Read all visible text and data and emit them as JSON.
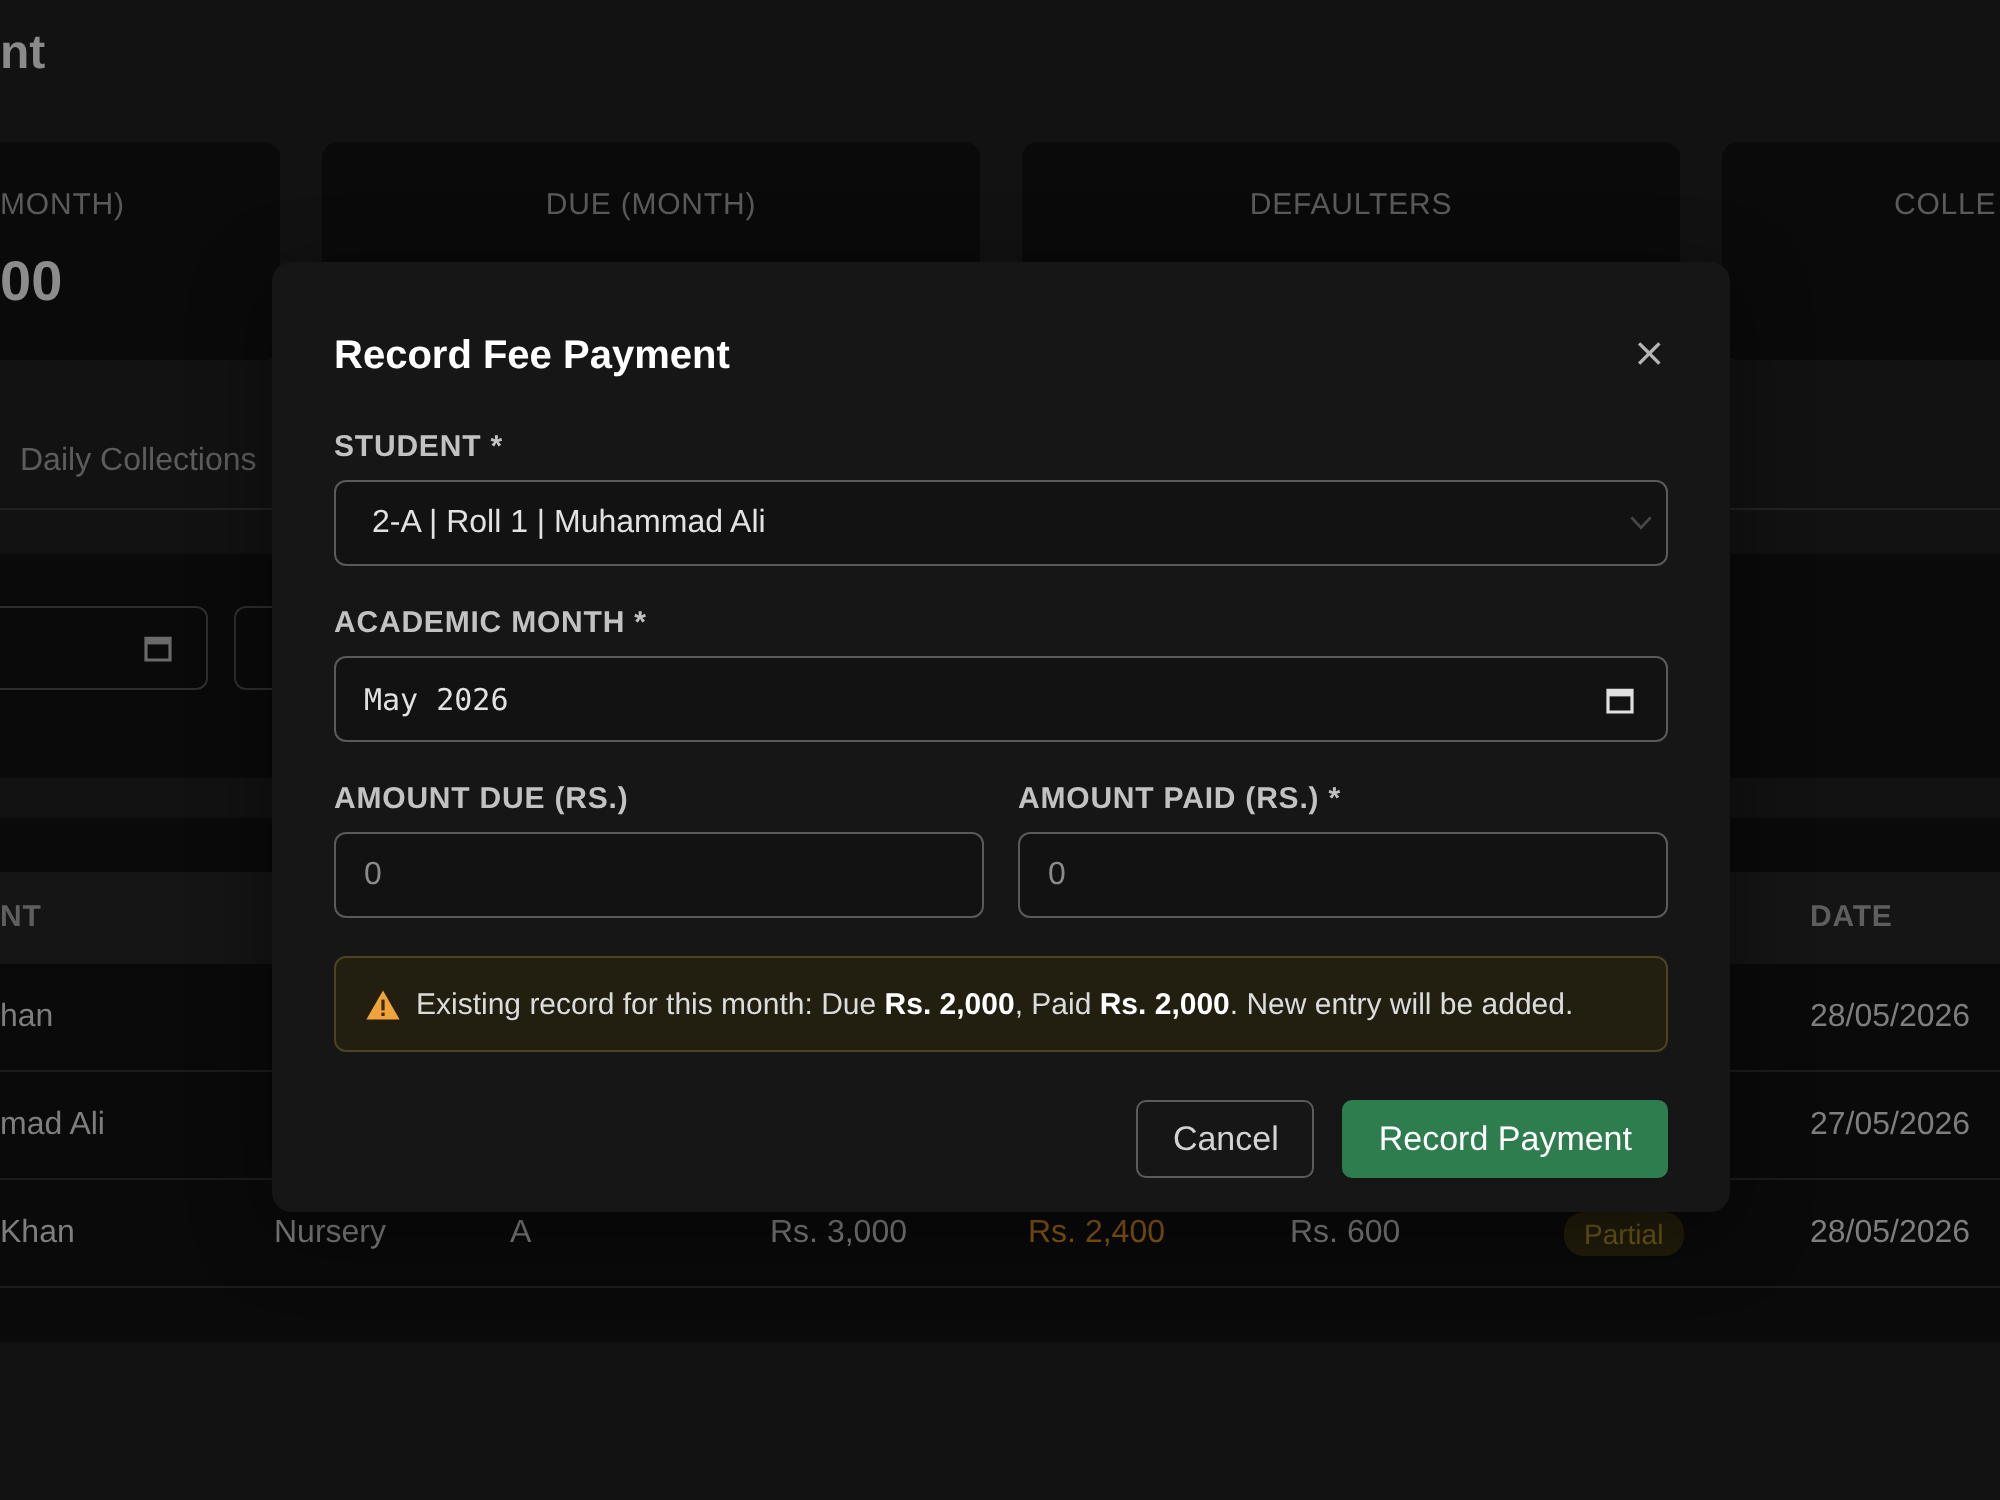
{
  "page_title": "nt",
  "stats": [
    {
      "label": "MONTH)",
      "value": "00"
    },
    {
      "label": "DUE (MONTH)"
    },
    {
      "label": "DEFAULTERS"
    },
    {
      "label": "COLLE"
    }
  ],
  "tabs": [
    {
      "label": "Daily Collections",
      "selected": false
    }
  ],
  "table": {
    "header": {
      "column_1": "NT",
      "date": "DATE"
    },
    "rows": [
      {
        "column_1": "han",
        "date": "28/05/2026"
      },
      {
        "column_1": "mad Ali",
        "date": "27/05/2026"
      },
      {
        "column_1": "Khan",
        "column_2": "Nursery",
        "column_3": "A",
        "column_4": "Rs. 3,000",
        "column_5": "Rs. 2,400",
        "column_6": "Rs. 600",
        "column_7": "Partial",
        "date": "28/05/2026"
      }
    ]
  },
  "modal": {
    "title": "Record Fee Payment",
    "close": "×",
    "fields": [
      {
        "kind": "select",
        "label": "STUDENT *",
        "value": "2-A | Roll 1 | Muhammad Ali"
      },
      {
        "kind": "month",
        "label": "ACADEMIC MONTH *",
        "value": "May 2026"
      },
      {
        "kind": "number",
        "label": "AMOUNT DUE (RS.)",
        "placeholder": "0"
      },
      {
        "kind": "number",
        "label": "AMOUNT PAID (RS.) *",
        "placeholder": "0"
      }
    ],
    "notice": "Existing record for this month: Due **Rs. 2,000**, Paid **Rs. 2,000**. New entry will be added.",
    "buttons": [
      {
        "kind": "secondary",
        "label": "Cancel"
      },
      {
        "kind": "primary",
        "label": "Record Payment"
      }
    ]
  }
}
